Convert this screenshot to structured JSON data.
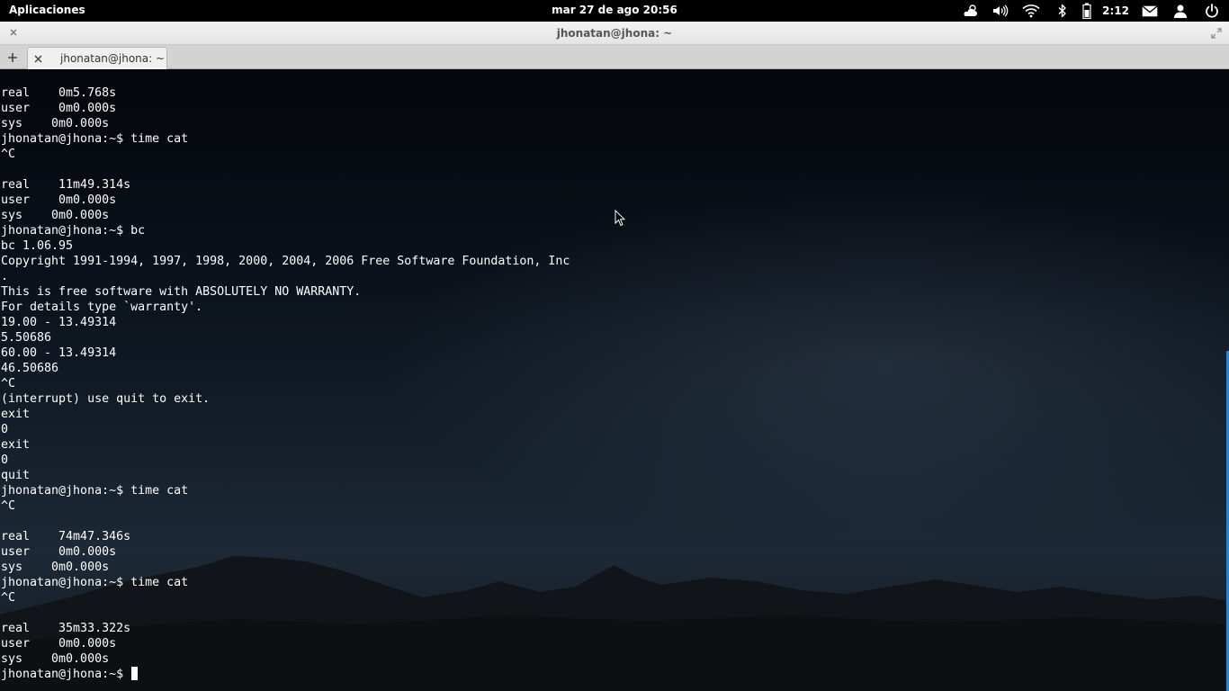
{
  "panel": {
    "apps_label": "Aplicaciones",
    "datetime": "mar 27 de ago 20:56",
    "battery_time": "2:12",
    "icons": [
      "weather-icon",
      "volume-icon",
      "wifi-icon",
      "bluetooth-icon",
      "battery-icon",
      "mail-icon",
      "user-icon",
      "power-icon"
    ]
  },
  "window": {
    "title": "jhonatan@jhona: ~"
  },
  "tabs": [
    {
      "label": "jhonatan@jhona: ~"
    }
  ],
  "terminal": {
    "lines": [
      "real\t0m5.768s",
      "user\t0m0.000s",
      "sys\t0m0.000s",
      "jhonatan@jhona:~$ time cat",
      "^C",
      "",
      "real\t11m49.314s",
      "user\t0m0.000s",
      "sys\t0m0.000s",
      "jhonatan@jhona:~$ bc",
      "bc 1.06.95",
      "Copyright 1991-1994, 1997, 1998, 2000, 2004, 2006 Free Software Foundation, Inc",
      ".",
      "This is free software with ABSOLUTELY NO WARRANTY.",
      "For details type `warranty'.",
      "19.00 - 13.49314",
      "5.50686",
      "60.00 - 13.49314",
      "46.50686",
      "^C",
      "(interrupt) use quit to exit.",
      "exit",
      "0",
      "exit",
      "0",
      "quit",
      "jhonatan@jhona:~$ time cat",
      "^C",
      "",
      "real\t74m47.346s",
      "user\t0m0.000s",
      "sys\t0m0.000s",
      "jhonatan@jhona:~$ time cat",
      "^C",
      "",
      "real\t35m33.322s",
      "user\t0m0.000s",
      "sys\t0m0.000s"
    ],
    "prompt": "jhonatan@jhona:~$ "
  },
  "colors": {
    "panel_bg": "#000000",
    "terminal_text": "#ffffff",
    "scroll_accent": "#1e88d8"
  }
}
